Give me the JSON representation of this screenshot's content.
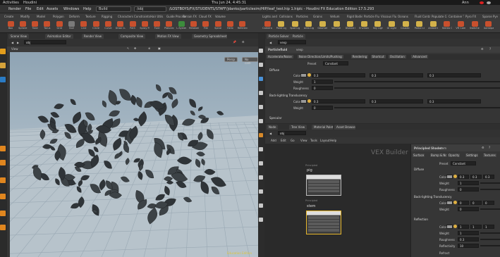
{
  "os": {
    "activities": "Activities",
    "app": "Houdini",
    "clock": "Thu Jun 24, 4:45:31",
    "user": "Ann"
  },
  "title": "/LOSTBOYS/FX/STUDENTS/STAFF/jdanko/particlesim/HIP/leaf_test.hip 1.hiplc - Houdini FX Education Edition 17.5.293",
  "menu": [
    "Render",
    "File",
    "Edit",
    "Assets",
    "Windows",
    "Help"
  ],
  "desktop": "Build",
  "context": "/obj",
  "shelf_tabs_left": [
    "Create",
    "Modify",
    "Model",
    "Polygon",
    "Deform",
    "Texture",
    "Rigging",
    "Characters",
    "Constraints",
    "Hair Utils",
    "Guide Process",
    "Terrain FX",
    "Cloud FX",
    "Volume"
  ],
  "shelf_tabs_right": [
    "Lights and Cameras",
    "Collisions",
    "Particles",
    "Grains",
    "Vellum",
    "Rigid Bodies",
    "Particle Fluids",
    "Viscous Fluids",
    "Oceans",
    "Fluid Containers",
    "Populate Containers",
    "Container Tools",
    "Pyro FX",
    "Sparse Pyro FX"
  ],
  "tools_left": [
    {
      "label": "Box",
      "color": "#c8502d"
    },
    {
      "label": "Sphere",
      "color": "#c8502d"
    },
    {
      "label": "Tube",
      "color": "#c8502d"
    },
    {
      "label": "Torus",
      "color": "#c8502d"
    },
    {
      "label": "Grid",
      "color": "#c8502d"
    },
    {
      "label": "Null",
      "color": "#7a7a7a"
    },
    {
      "label": "Line",
      "color": "#c8502d"
    },
    {
      "label": "Circle",
      "color": "#c8502d"
    },
    {
      "label": "Curve",
      "color": "#c8502d"
    },
    {
      "label": "Draw Curve",
      "color": "#c8502d"
    },
    {
      "label": "Path",
      "color": "#c8502d"
    },
    {
      "label": "Spray Paint",
      "color": "#c8502d"
    },
    {
      "label": "Font",
      "color": "#c8502d"
    },
    {
      "label": "Platonic",
      "color": "#c8502d"
    },
    {
      "label": "L-System",
      "color": "#3c8c3c"
    },
    {
      "label": "Metaball",
      "color": "#c8502d"
    },
    {
      "label": "File",
      "color": "#c8502d"
    },
    {
      "label": "Spiral",
      "color": "#c8502d"
    },
    {
      "label": "Helix",
      "color": "#c8502d"
    },
    {
      "label": "Reference",
      "color": "#c8502d"
    }
  ],
  "tools_right": [
    {
      "label": "Camera",
      "color": "#c8502d"
    },
    {
      "label": "Point Light",
      "color": "#d3b24a"
    },
    {
      "label": "Spot Light",
      "color": "#d3b24a"
    },
    {
      "label": "Area Light",
      "color": "#d3b24a"
    },
    {
      "label": "Geometry Light",
      "color": "#d3b24a"
    },
    {
      "label": "Volume Light",
      "color": "#d3b24a"
    },
    {
      "label": "Distant Light",
      "color": "#d3b24a"
    },
    {
      "label": "Environment Light",
      "color": "#d3b24a"
    },
    {
      "label": "Sky Light",
      "color": "#d3b24a"
    },
    {
      "label": "GI Light",
      "color": "#d3b24a"
    },
    {
      "label": "Caustic Light",
      "color": "#d3b24a"
    },
    {
      "label": "Portal Light",
      "color": "#d3b24a"
    },
    {
      "label": "Ambient Light",
      "color": "#d3b24a"
    },
    {
      "label": "Stereo Camera",
      "color": "#c8502d"
    },
    {
      "label": "VR Camera",
      "color": "#c8502d"
    },
    {
      "label": "Switcher",
      "color": "#c8502d"
    },
    {
      "label": "Gamepad Camera",
      "color": "#c8502d"
    }
  ],
  "viewport": {
    "tabs": [
      "Scene View",
      "Animation Editor",
      "Render View",
      "Composite View",
      "Motion FX View",
      "Geometry Spreadsheet"
    ],
    "path": "obj",
    "label": "View",
    "persp": "Persp",
    "cam": "No cam",
    "status": "Education Edition"
  },
  "params": {
    "tabs": [
      "Particle Solver",
      "Particle"
    ],
    "node": "Particlefluid",
    "name": "vexp",
    "subtabs": [
      "Accelerate/Noise",
      "Noise Direction/Limits/Pushing",
      "Rendering",
      "Shortcut",
      "Oscillation",
      "Advanced"
    ],
    "preset": "Preset",
    "preset_val": "Constant",
    "section": "Diffuse",
    "rows": [
      {
        "label": "Color",
        "v": [
          "0.3",
          "0.3",
          "0.3"
        ]
      },
      {
        "label": "Weight",
        "v": [
          "1"
        ]
      },
      {
        "label": "Roughness",
        "v": [
          "0"
        ]
      }
    ],
    "section2": "Back-lighting Translucency",
    "rows2": [
      {
        "label": "Color",
        "v": [
          "0.3",
          "0.3",
          "0.3"
        ]
      },
      {
        "label": "Weight",
        "v": [
          "0"
        ]
      }
    ],
    "section3": "Specular"
  },
  "network": {
    "tabs": [
      "Node",
      "Tree View",
      "Material Palette",
      "Asset Browser"
    ],
    "path": "obj",
    "menu": [
      "Add",
      "Edit",
      "Go",
      "View",
      "Tools",
      "Layout",
      "Help"
    ],
    "title": "VEX Builder",
    "nodes": [
      {
        "tag": "Principled",
        "name": "pig"
      },
      {
        "tag": "Principled",
        "name": "stem"
      }
    ]
  },
  "shader": {
    "header": "Principled Shader",
    "name": "stem",
    "tabs": [
      "Surface",
      "Bump & Normals",
      "Opacity",
      "Settings",
      "Textures"
    ],
    "preset": "Preset",
    "preset_val": "Constant",
    "section": "Diffuse",
    "rows": [
      {
        "label": "Color",
        "v": [
          "0.3",
          "0.3",
          "0.3"
        ]
      },
      {
        "label": "Weight",
        "v": [
          "1"
        ]
      },
      {
        "label": "Roughness",
        "v": [
          "0"
        ]
      }
    ],
    "section2": "Back-lighting Translucency",
    "rows2": [
      {
        "label": "Color",
        "v": [
          "0",
          "0",
          "0"
        ]
      },
      {
        "label": "Weight",
        "v": [
          "0"
        ]
      }
    ],
    "section3": "Reflection",
    "rows3": [
      {
        "label": "Color",
        "v": [
          "1",
          "1",
          "1"
        ]
      },
      {
        "label": "Weight",
        "v": [
          "1"
        ]
      },
      {
        "label": "Roughness",
        "v": [
          "0.3"
        ]
      },
      {
        "label": "Reflectivity",
        "v": [
          "10"
        ]
      }
    ],
    "footer": "Refract"
  }
}
